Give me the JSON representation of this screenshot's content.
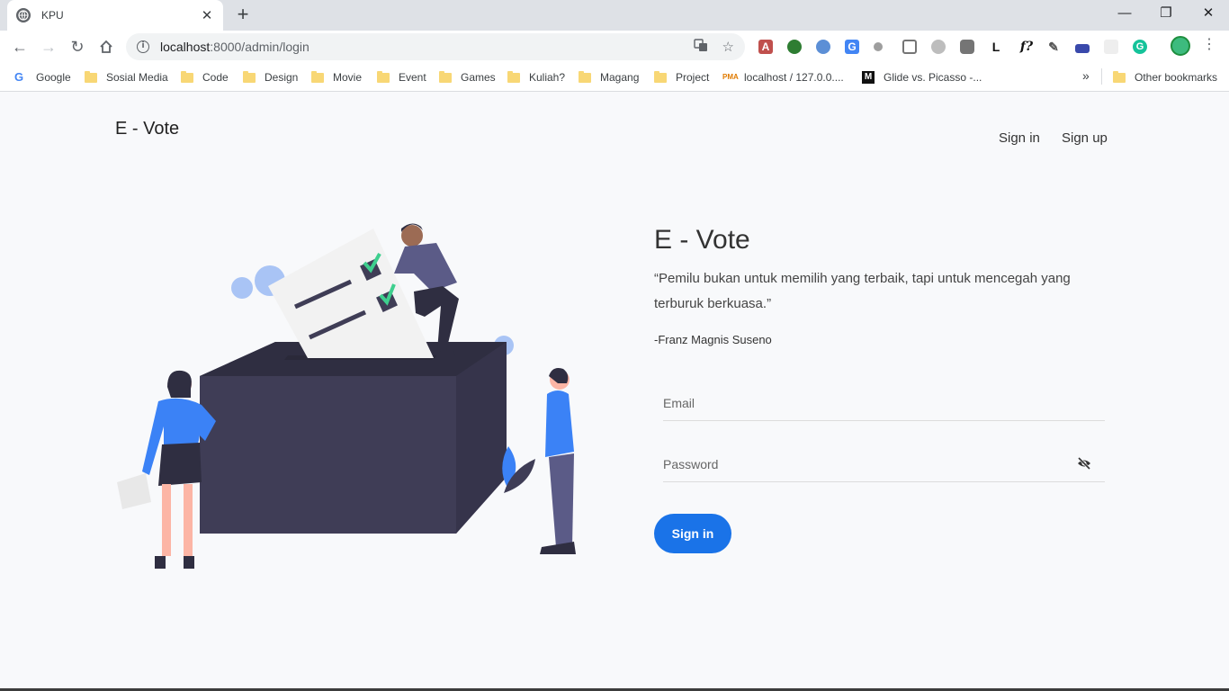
{
  "browser": {
    "tab_title": "KPU",
    "tab_close": "✕",
    "new_tab": "+",
    "url_host": "localhost",
    "url_path": ":8000/admin/login",
    "window_controls": {
      "minimize": "—",
      "restore": "❐",
      "close": "✕"
    },
    "bookmarks": [
      {
        "label": "Google",
        "icon": "google-icon"
      },
      {
        "label": "Sosial Media",
        "icon": "folder-icon"
      },
      {
        "label": "Code",
        "icon": "folder-icon"
      },
      {
        "label": "Design",
        "icon": "folder-icon"
      },
      {
        "label": "Movie",
        "icon": "folder-icon"
      },
      {
        "label": "Event",
        "icon": "folder-icon"
      },
      {
        "label": "Games",
        "icon": "folder-icon"
      },
      {
        "label": "Kuliah?",
        "icon": "folder-icon"
      },
      {
        "label": "Magang",
        "icon": "folder-icon"
      },
      {
        "label": "Project",
        "icon": "folder-icon"
      },
      {
        "label": "localhost / 127.0.0....",
        "icon": "phpmyadmin-icon"
      },
      {
        "label": "Glide vs. Picasso -...",
        "icon": "medium-icon"
      }
    ],
    "bookmarks_more": "»",
    "other_bookmarks": "Other bookmarks"
  },
  "page": {
    "brand": "E - Vote",
    "nav": {
      "signin": "Sign in",
      "signup": "Sign up"
    },
    "hero": {
      "title": "E - Vote",
      "quote": "“Pemilu bukan untuk memilih yang terbaik, tapi untuk mencegah yang terburuk berkuasa.”",
      "author": "-Franz Magnis Suseno"
    },
    "form": {
      "email_placeholder": "Email",
      "password_placeholder": "Password",
      "submit": "Sign in"
    }
  },
  "colors": {
    "accent": "#1a73e8",
    "box": "#3f3d56",
    "check": "#3ecf8e",
    "person_blue": "#3b82f6",
    "circle": "#a9c4f5"
  }
}
